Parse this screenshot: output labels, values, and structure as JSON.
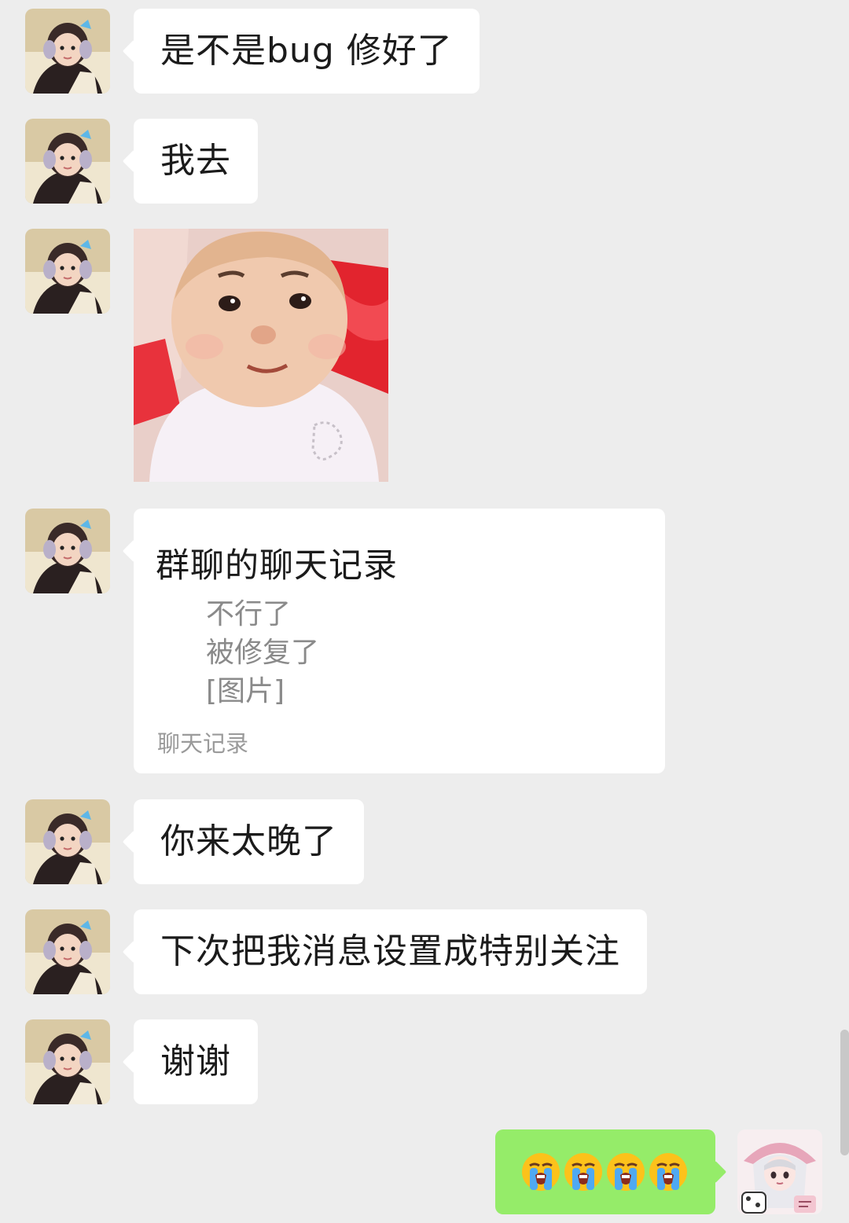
{
  "messages": [
    {
      "sender": "other",
      "type": "text",
      "text": "是不是bug 修好了"
    },
    {
      "sender": "other",
      "type": "text",
      "text": "我去"
    },
    {
      "sender": "other",
      "type": "image",
      "description_icon": "baby-photo"
    },
    {
      "sender": "other",
      "type": "chat-record",
      "title": "群聊的聊天记录",
      "lines": [
        "不行了",
        "被修复了",
        "[图片]"
      ],
      "footer": "聊天记录"
    },
    {
      "sender": "other",
      "type": "text",
      "text": "你来太晚了"
    },
    {
      "sender": "other",
      "type": "text",
      "text": "下次把我消息设置成特别关注"
    },
    {
      "sender": "other",
      "type": "text",
      "text": "谢谢"
    },
    {
      "sender": "self",
      "type": "emoji",
      "emojis": [
        "loudly-crying-face",
        "loudly-crying-face",
        "loudly-crying-face",
        "loudly-crying-face"
      ]
    }
  ],
  "colors": {
    "background": "#ededed",
    "incoming_bubble": "#ffffff",
    "outgoing_bubble": "#95ec69",
    "text": "#1b1b1b",
    "secondary_text": "#8a8a8a"
  }
}
